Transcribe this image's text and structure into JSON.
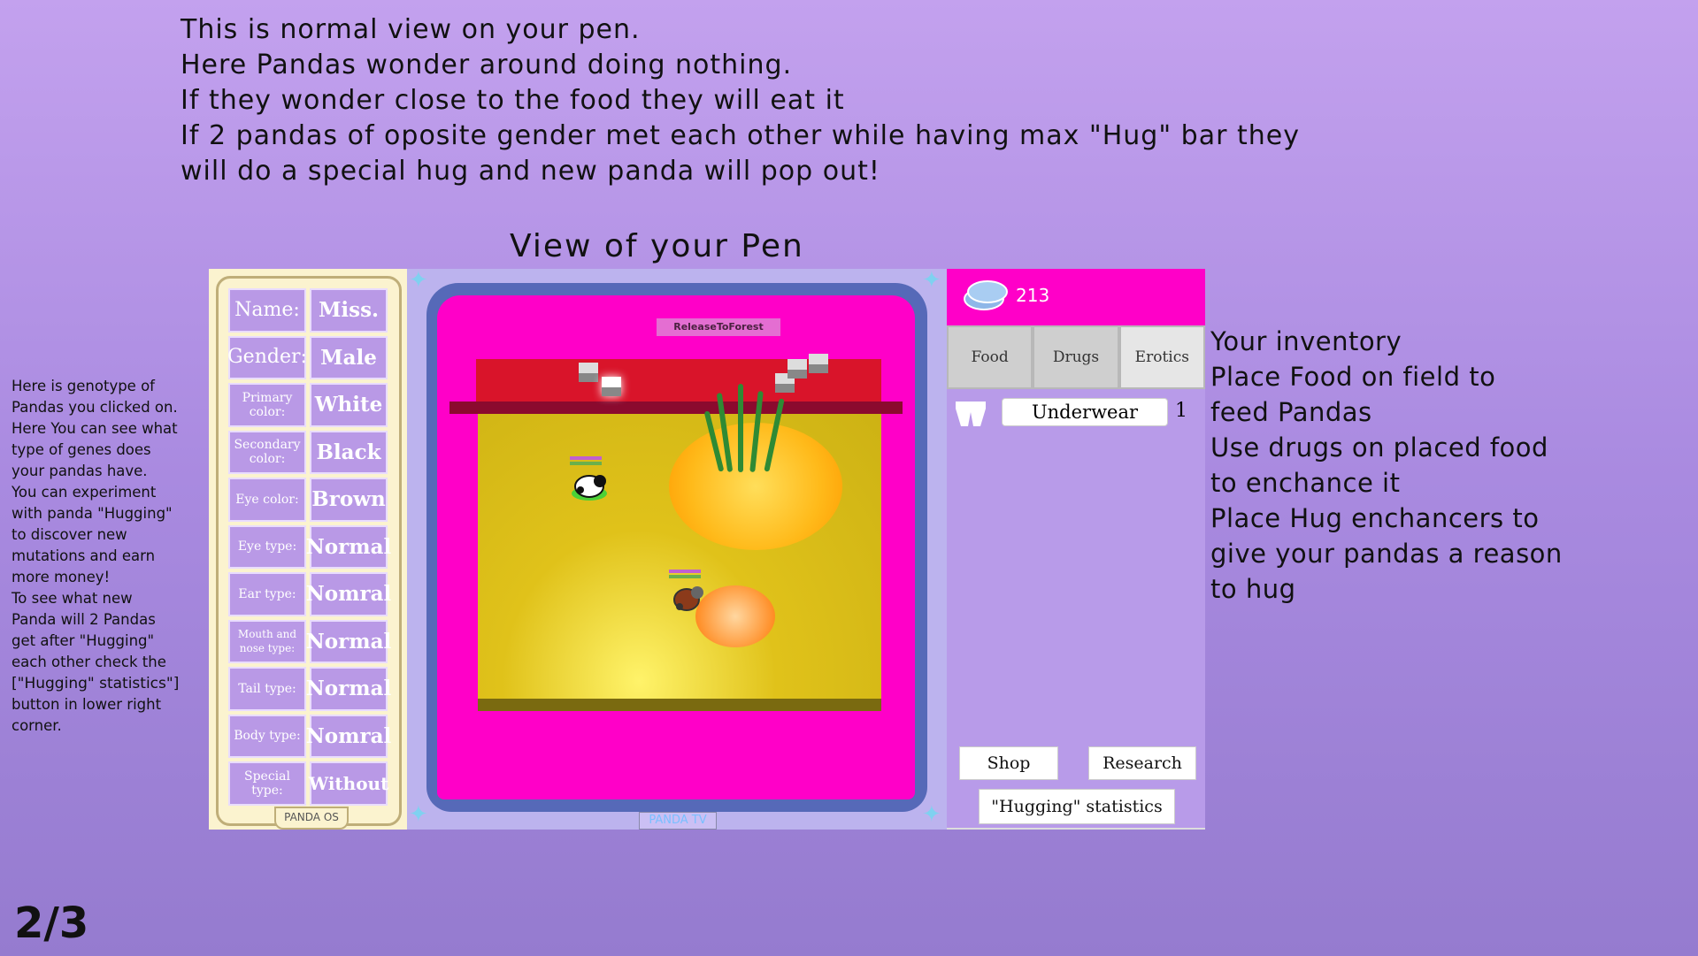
{
  "intro_lines": [
    "This is normal view on your pen.",
    "Here Pandas wonder around doing nothing.",
    "If they wonder close to the food they will eat it",
    "If 2 pandas of oposite gender met each other while having max \"Hug\" bar they",
    "will do a special hug and new panda will pop out!"
  ],
  "pen_title": "View of your Pen",
  "left_note_lines": [
    "Here is genotype of",
    "Pandas you clicked on.",
    "Here You can see what",
    "type of genes does",
    "your pandas have.",
    "You can experiment",
    "with panda \"Hugging\"",
    "to discover new",
    "mutations and earn",
    "more money!",
    "To see what new",
    "Panda will 2 Pandas",
    "get after \"Hugging\"",
    "each other check the",
    "[\"Hugging\" statistics\"]",
    "button in lower right",
    "corner."
  ],
  "right_note_lines": [
    "Your inventory",
    "Place Food on field to",
    "feed Pandas",
    "Use drugs on placed food",
    "to enchance it",
    "Place Hug enchancers to",
    "give your pandas a reason",
    "to hug"
  ],
  "page_number": "2/3",
  "genotype": {
    "rows": [
      {
        "key": "Name:",
        "value": "Miss."
      },
      {
        "key": "Gender:",
        "value": "Male"
      },
      {
        "key": "Primary color:",
        "value": "White"
      },
      {
        "key": "Secondary color:",
        "value": "Black"
      },
      {
        "key": "Eye color:",
        "value": "Brown"
      },
      {
        "key": "Eye type:",
        "value": "Normal"
      },
      {
        "key": "Ear type:",
        "value": "Nomral"
      },
      {
        "key": "Mouth and nose type:",
        "value": "Normal"
      },
      {
        "key": "Tail type:",
        "value": "Normal"
      },
      {
        "key": "Body type:",
        "value": "Nomral"
      },
      {
        "key": "Special type:",
        "value": "Without"
      }
    ],
    "os_label": "PANDA OS"
  },
  "pen": {
    "release_button": "ReleaseToForest",
    "tv_label": "PANDA TV"
  },
  "inventory": {
    "money": "213",
    "tabs": [
      "Food",
      "Drugs",
      "Erotics"
    ],
    "active_tab": "Erotics",
    "items": [
      {
        "name": "Underwear",
        "qty": "1",
        "icon": "underwear-icon"
      }
    ],
    "shop_button": "Shop",
    "research_button": "Research",
    "stats_button": "\"Hugging\" statistics"
  },
  "colors": {
    "background": "#b898e8",
    "pen_pink": "#ff00c8",
    "panel_cream": "#fbf3cf",
    "gene_cell": "#b999e6"
  }
}
